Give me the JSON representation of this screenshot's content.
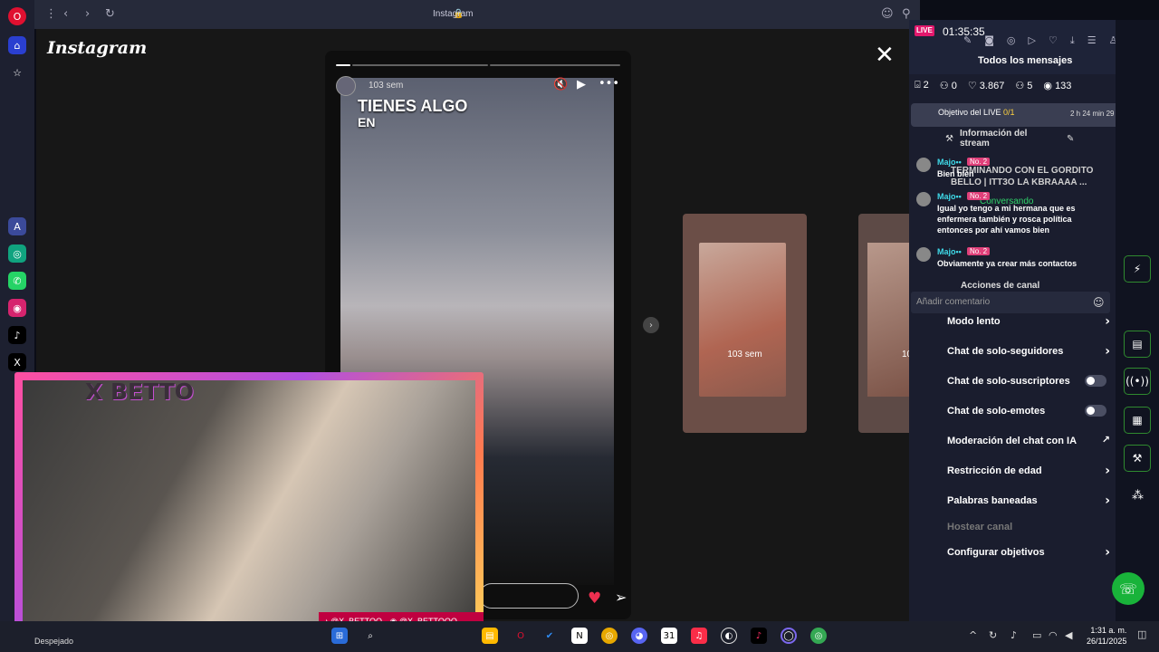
{
  "browser": {
    "address": "Instagram",
    "back": "‹",
    "forward": "›",
    "reload": "↻"
  },
  "instagram": {
    "logo": "Instagram",
    "close": "✕",
    "story": {
      "time": "103 sem",
      "headline_1": "TIENES ALGO",
      "headline_2": "EN"
    },
    "preview_1_time": "103 sem",
    "preview_2_time": "10"
  },
  "overlay": {
    "name": "X BETTO",
    "tiktok": "@X_BETTOO",
    "instagram": "@X_BETTOOO"
  },
  "live": {
    "badge": "LIVE",
    "timer": "01:35:35",
    "all_messages": "Todos los mensajes",
    "stats": {
      "gifts": "2",
      "follows": "0",
      "likes": "3.867",
      "members": "5",
      "viewers": "133"
    },
    "goal_label": "Objetivo del LIVE ",
    "goal_value": "0/1",
    "goal_time": "2 h 24 min 29 s",
    "stream_info": "Información del stream",
    "stream_title": "TERMINANDO CON EL GORDITO BELLO | ITT3O LA KBRAAAA ...",
    "conversando": "Conversando",
    "channel_actions": "Acciones de canal",
    "comment_placeholder": "Añadir comentario",
    "messages": [
      {
        "user": "Majo••",
        "badge": "No. 2",
        "text": "Bien bien"
      },
      {
        "user": "Majo••",
        "badge": "No. 2",
        "text": "Igual yo tengo a mi hermana que es enfermera también y rosca política entonces por ahí vamos bien"
      },
      {
        "user": "Majo••",
        "badge": "No. 2",
        "text": "Obviamente ya crear más contactos"
      }
    ],
    "settings": {
      "slow_mode": "Modo lento",
      "followers_only": "Chat de solo-seguidores",
      "subscribers_only": "Chat de solo-suscriptores",
      "emotes_only": "Chat de solo-emotes",
      "ai_moderation": "Moderación del chat con IA",
      "age_restriction": "Restricción de edad",
      "banned_words": "Palabras baneadas",
      "host_channel": "Hostear canal",
      "configure_goals": "Configurar objetivos"
    }
  },
  "taskbar": {
    "weather": "Despejado",
    "time": "1:31 a. m.",
    "date": "26/11/2025"
  },
  "colors": {
    "live_pink": "#e3186d",
    "accent_green": "#19b33a",
    "chat_user_cyan": "#3fd9e8"
  }
}
